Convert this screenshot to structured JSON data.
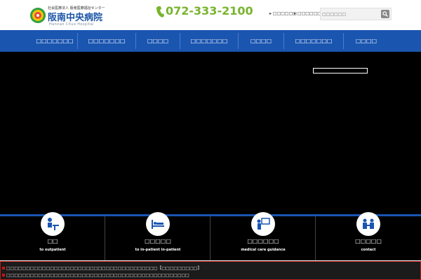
{
  "header": {
    "logo_top": "社会医療法人 阪南医療福祉センター",
    "logo_main": "阪南中央病院",
    "logo_sub": "Hannan Chuo Hospital",
    "phone_icon": "phone-icon",
    "phone": "072-333-2100",
    "links": [
      "□□□□□□",
      "□□□□□□□□"
    ],
    "search_placeholder": "□□□□□□"
  },
  "nav": {
    "items": [
      "□□□□□□□",
      "□□□□□□□",
      "□□□□",
      "□□□□□□□",
      "□□□□",
      "□□□□□□□",
      "□□□□"
    ]
  },
  "hero": {
    "background": "#000000"
  },
  "quick_links": [
    {
      "jp": "□□",
      "en": "to outpatient",
      "icon": "outpatient-doctor-icon"
    },
    {
      "jp": "□□□□□",
      "en": "to in-patient in-patient",
      "icon": "hospital-bed-icon"
    },
    {
      "jp": "□□□□□□",
      "en": "medical care guidance",
      "icon": "guidance-board-icon"
    },
    {
      "jp": "□□□□□",
      "en": "contact",
      "icon": "contact-people-icon"
    }
  ],
  "news": {
    "items": [
      "□□□□□□□□□□□□□□□□□□□□□□□□□□□□□□□□□□□□□□【□□□□□□□□□】",
      "□□□□□□□□□□□□□□□□□□□□□□□□□□□□□□□□□□□□□□□□□□□□□□"
    ]
  },
  "colors": {
    "brand_blue": "#1a55b0",
    "phone_green": "#78b42e",
    "news_red": "#c01818"
  }
}
